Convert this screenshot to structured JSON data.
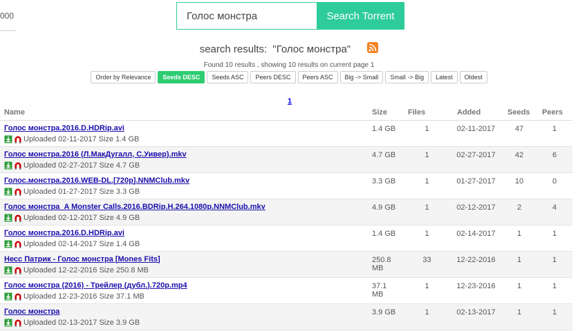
{
  "left_fragment": "000",
  "search": {
    "value": "Голос монстра",
    "button": "Search Torrent"
  },
  "results": {
    "prefix": "search results:",
    "query": "\"Голос монстра\"",
    "found": "Found 10 results , showing 10 results on current page 1"
  },
  "sort": [
    "Order by Relevance",
    "Seeds DESC",
    "Seeds ASC",
    "Peers DESC",
    "Peers ASC",
    "Big -> Small",
    "Small -> Big",
    "Latest",
    "Oldest"
  ],
  "sort_active": "Seeds DESC",
  "page": "1",
  "columns": {
    "name": "Name",
    "size": "Size",
    "files": "Files",
    "added": "Added",
    "seeds": "Seeds",
    "peers": "Peers"
  },
  "rows": [
    {
      "name": "Голос монстра.2016.D.HDRip.avi",
      "meta": "Uploaded 02-11-2017 Size 1.4 GB",
      "size": "1.4 GB",
      "files": "1",
      "added": "02-11-2017",
      "seeds": "47",
      "peers": "1"
    },
    {
      "name": "Голос монстра.2016 (Л.МакДугалл, С.Уивер).mkv",
      "meta": "Uploaded 02-27-2017 Size 4.7 GB",
      "size": "4.7 GB",
      "files": "1",
      "added": "02-27-2017",
      "seeds": "42",
      "peers": "6"
    },
    {
      "name": "Голос.монстра.2016.WEB-DL.[720p].NNMClub.mkv",
      "meta": "Uploaded 01-27-2017 Size 3.3 GB",
      "size": "3.3 GB",
      "files": "1",
      "added": "01-27-2017",
      "seeds": "10",
      "peers": "0"
    },
    {
      "name": "Голос монстра_A Monster Calls.2016.BDRip.H.264.1080p.NNMClub.mkv",
      "meta": "Uploaded 02-12-2017 Size 4.9 GB",
      "size": "4.9 GB",
      "files": "1",
      "added": "02-12-2017",
      "seeds": "2",
      "peers": "4"
    },
    {
      "name": "Голос монстра.2016.D.HDRip.avi",
      "meta": "Uploaded 02-14-2017 Size 1.4 GB",
      "size": "1.4 GB",
      "files": "1",
      "added": "02-14-2017",
      "seeds": "1",
      "peers": "1"
    },
    {
      "name": "Несс Патрик - Голос монстра [Mones Fits]",
      "meta": "Uploaded 12-22-2016 Size 250.8 MB",
      "size": "250.8 MB",
      "files": "33",
      "added": "12-22-2016",
      "seeds": "1",
      "peers": "1"
    },
    {
      "name": "Голос монстра (2016) - Трейлер (дубл.).720p.mp4",
      "meta": "Uploaded 12-23-2016 Size 37.1 MB",
      "size": "37.1 MB",
      "files": "1",
      "added": "12-23-2016",
      "seeds": "1",
      "peers": "1"
    },
    {
      "name": "Голос монстра",
      "meta": "Uploaded 02-13-2017 Size 3.9 GB",
      "size": "3.9 GB",
      "files": "1",
      "added": "02-13-2017",
      "seeds": "1",
      "peers": "1"
    }
  ],
  "colors": {
    "accent": "#2ecc9a",
    "active_sort": "#2ecc71",
    "link": "#1a0dab",
    "rss": "#f58220",
    "magnet": "#cc0000",
    "download": "#2e9c3a"
  }
}
